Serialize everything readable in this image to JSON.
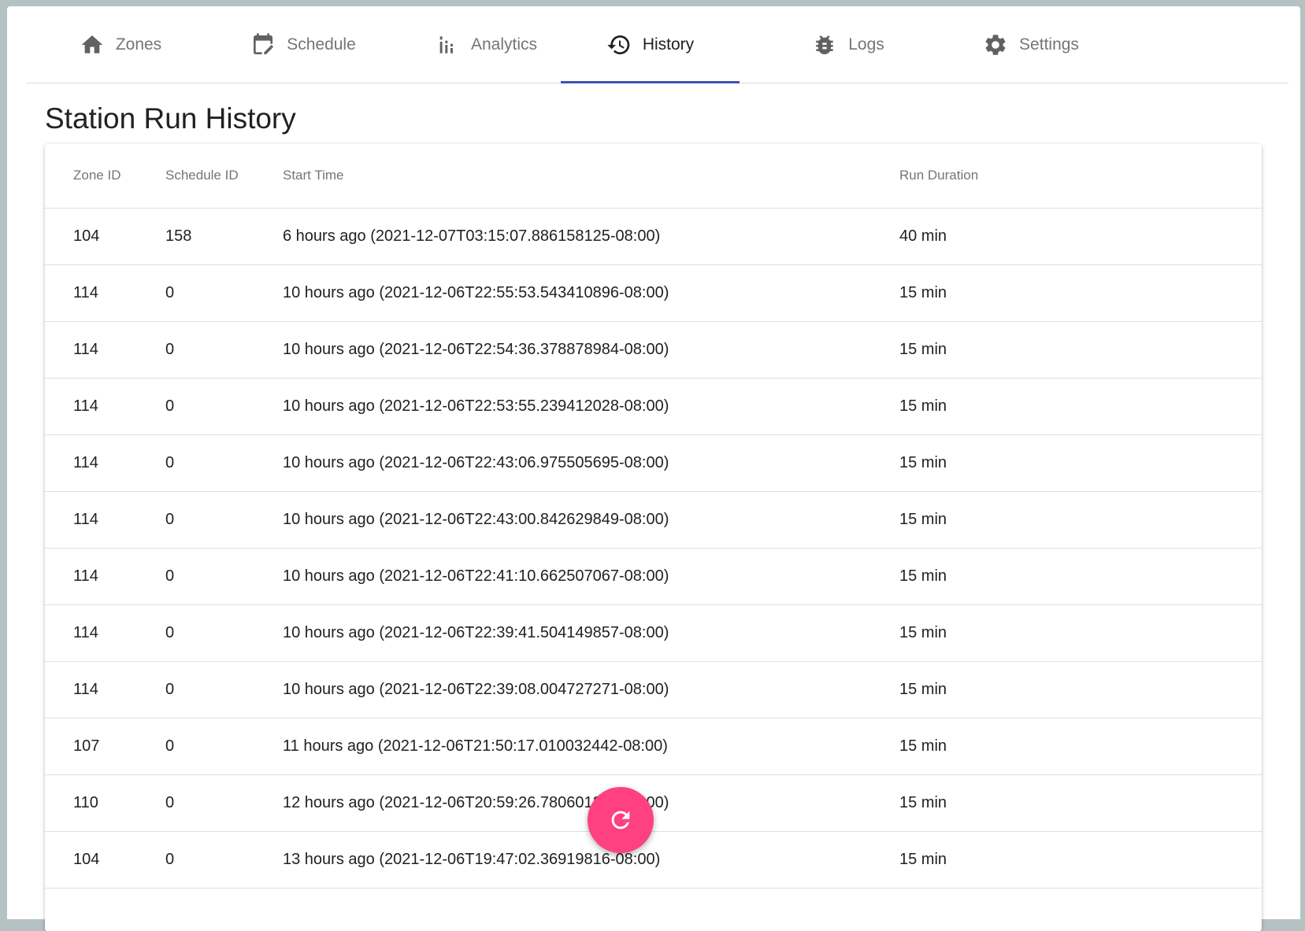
{
  "nav": {
    "tabs": [
      {
        "label": "Zones",
        "icon": "home-icon"
      },
      {
        "label": "Schedule",
        "icon": "calendar-edit-icon"
      },
      {
        "label": "Analytics",
        "icon": "bar-chart-icon"
      },
      {
        "label": "History",
        "icon": "history-icon",
        "active": true
      },
      {
        "label": "Logs",
        "icon": "bug-icon"
      },
      {
        "label": "Settings",
        "icon": "gear-icon"
      }
    ]
  },
  "page": {
    "title": "Station Run History"
  },
  "table": {
    "columns": [
      "Zone ID",
      "Schedule ID",
      "Start Time",
      "Run Duration"
    ],
    "rows": [
      {
        "zone": "104",
        "schedule": "158",
        "start": "6 hours ago (2021-12-07T03:15:07.886158125-08:00)",
        "duration": "40 min"
      },
      {
        "zone": "114",
        "schedule": "0",
        "start": "10 hours ago (2021-12-06T22:55:53.543410896-08:00)",
        "duration": "15 min"
      },
      {
        "zone": "114",
        "schedule": "0",
        "start": "10 hours ago (2021-12-06T22:54:36.378878984-08:00)",
        "duration": "15 min"
      },
      {
        "zone": "114",
        "schedule": "0",
        "start": "10 hours ago (2021-12-06T22:53:55.239412028-08:00)",
        "duration": "15 min"
      },
      {
        "zone": "114",
        "schedule": "0",
        "start": "10 hours ago (2021-12-06T22:43:06.975505695-08:00)",
        "duration": "15 min"
      },
      {
        "zone": "114",
        "schedule": "0",
        "start": "10 hours ago (2021-12-06T22:43:00.842629849-08:00)",
        "duration": "15 min"
      },
      {
        "zone": "114",
        "schedule": "0",
        "start": "10 hours ago (2021-12-06T22:41:10.662507067-08:00)",
        "duration": "15 min"
      },
      {
        "zone": "114",
        "schedule": "0",
        "start": "10 hours ago (2021-12-06T22:39:41.504149857-08:00)",
        "duration": "15 min"
      },
      {
        "zone": "114",
        "schedule": "0",
        "start": "10 hours ago (2021-12-06T22:39:08.004727271-08:00)",
        "duration": "15 min"
      },
      {
        "zone": "107",
        "schedule": "0",
        "start": "11 hours ago (2021-12-06T21:50:17.010032442-08:00)",
        "duration": "15 min"
      },
      {
        "zone": "110",
        "schedule": "0",
        "start": "12 hours ago (2021-12-06T20:59:26.780601234-08:00)",
        "duration": "15 min"
      },
      {
        "zone": "104",
        "schedule": "0",
        "start": "13 hours ago (2021-12-06T19:47:02.36919816-08:00)",
        "duration": "15 min"
      }
    ]
  },
  "fab": {
    "icon": "refresh-icon",
    "color": "#ff4081"
  },
  "colors": {
    "accent": "#3f51b5",
    "fab": "#ff4081",
    "background": "#b4c2c4"
  }
}
